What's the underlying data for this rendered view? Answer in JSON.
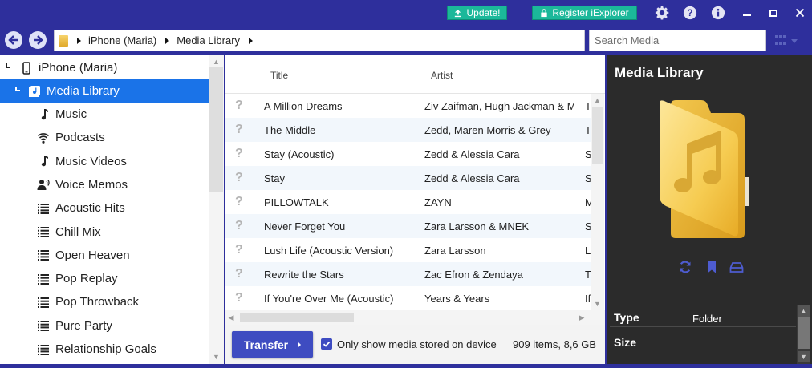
{
  "titlebar": {
    "update_label": "Update!",
    "register_label": "Register iExplorer",
    "icons": [
      "gear-icon",
      "help-icon",
      "info-icon",
      "minimize-icon",
      "maximize-icon",
      "close-icon"
    ]
  },
  "nav": {
    "breadcrumb": [
      "iPhone (Maria)",
      "Media Library"
    ],
    "search_placeholder": "Search Media"
  },
  "tree": {
    "device": "iPhone (Maria)",
    "selected": "Media Library",
    "items": [
      {
        "label": "Music",
        "icon": "music-note-icon"
      },
      {
        "label": "Podcasts",
        "icon": "podcast-icon"
      },
      {
        "label": "Music Videos",
        "icon": "music-note-icon"
      },
      {
        "label": "Voice Memos",
        "icon": "voice-memo-icon"
      },
      {
        "label": "Acoustic Hits",
        "icon": "playlist-icon"
      },
      {
        "label": "Chill Mix",
        "icon": "playlist-icon"
      },
      {
        "label": "Open Heaven",
        "icon": "playlist-icon"
      },
      {
        "label": "Pop Replay",
        "icon": "playlist-icon"
      },
      {
        "label": "Pop Throwback",
        "icon": "playlist-icon"
      },
      {
        "label": "Pure Party",
        "icon": "playlist-icon"
      },
      {
        "label": "Relationship Goals",
        "icon": "playlist-icon"
      }
    ]
  },
  "table": {
    "columns": [
      "Title",
      "Artist"
    ],
    "rows": [
      {
        "status": "?",
        "title": "A Million Dreams",
        "artist": "Ziv Zaifman, Hugh Jackman & M",
        "extra": "T"
      },
      {
        "status": "?",
        "title": "The Middle",
        "artist": "Zedd, Maren Morris & Grey",
        "extra": "T"
      },
      {
        "status": "?",
        "title": "Stay (Acoustic)",
        "artist": "Zedd & Alessia Cara",
        "extra": "S"
      },
      {
        "status": "?",
        "title": "Stay",
        "artist": "Zedd & Alessia Cara",
        "extra": "S"
      },
      {
        "status": "?",
        "title": "PILLOWTALK",
        "artist": "ZAYN",
        "extra": "M"
      },
      {
        "status": "?",
        "title": "Never Forget You",
        "artist": "Zara Larsson & MNEK",
        "extra": "S"
      },
      {
        "status": "?",
        "title": "Lush Life (Acoustic Version)",
        "artist": "Zara Larsson",
        "extra": "L"
      },
      {
        "status": "?",
        "title": "Rewrite the Stars",
        "artist": "Zac Efron & Zendaya",
        "extra": "T"
      },
      {
        "status": "?",
        "title": "If You're Over Me (Acoustic)",
        "artist": "Years & Years",
        "extra": "If"
      }
    ]
  },
  "footer": {
    "transfer_label": "Transfer",
    "checkbox_label": "Only show media stored on device",
    "checkbox_checked": true,
    "count": "909 items, 8,6 GB"
  },
  "detail": {
    "title": "Media Library",
    "props": [
      {
        "key": "Type",
        "value": "Folder"
      },
      {
        "key": "Size",
        "value": ""
      }
    ]
  },
  "colors": {
    "chrome": "#2e2f9c",
    "accent_green": "#1bb89a",
    "selection": "#1a73e8",
    "button": "#3e4cc1",
    "detail_bg": "#2b2b2b"
  }
}
